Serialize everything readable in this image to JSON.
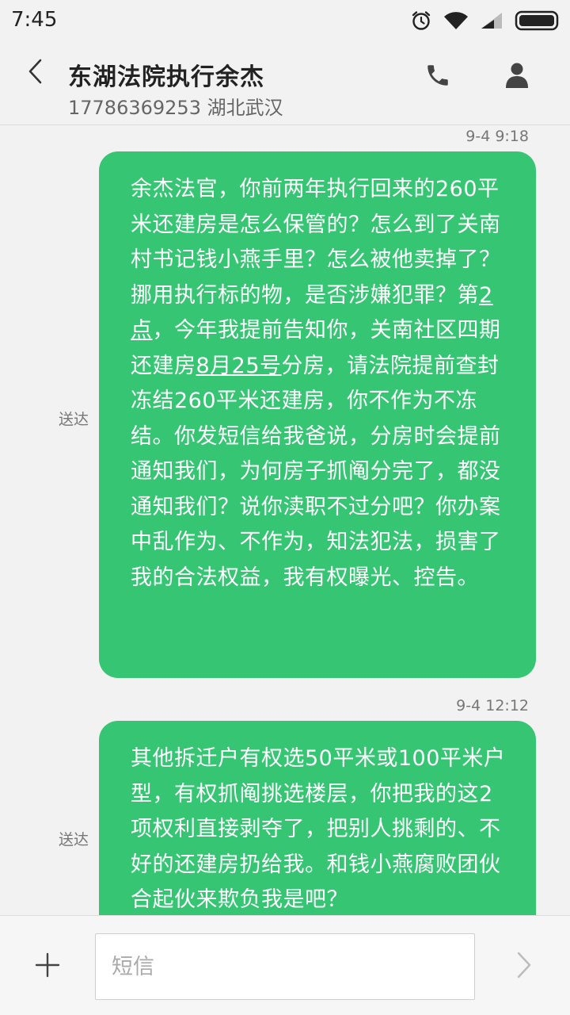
{
  "status_bar": {
    "time": "7:45"
  },
  "header": {
    "contact_name": "东湖法院执行余杰",
    "contact_sub": "17786369253 湖北武汉"
  },
  "messages": [
    {
      "timestamp": "9-4 9:18",
      "status": "送达",
      "parts": {
        "a": "余杰法官，你前两年执行回来的260平米还建房是怎么保管的？怎么到了关南村书记钱小燕手里？怎么被他卖掉了？挪用执行标的物，是否涉嫌犯罪？第",
        "link1": "2点",
        "b": "，今年我提前告知你，关南社区四期还建房",
        "link2": "8月25号",
        "c": "分房，请法院提前查封冻结260平米还建房，你不作为不冻结。你发短信给我爸说，分房时会提前通知我们，为何房子抓阄分完了，都没通知我们？说你渎职不过分吧？你办案中乱作为、不作为，知法犯法，损害了我的合法权益，我有权曝光、控告。"
      }
    },
    {
      "timestamp": "9-4 12:12",
      "status": "送达",
      "text": "其他拆迁户有权选50平米或100平米户型，有权抓阄挑选楼层，你把我的这2项权利直接剥夺了，把别人挑剩的、不好的还建房扔给我。和钱小燕腐败团伙合起伙来欺负我是吧？"
    }
  ],
  "input_bar": {
    "placeholder": "短信",
    "value": ""
  },
  "colors": {
    "bubble": "#36c573",
    "background": "#f2f2f2"
  },
  "icons": [
    "back-arrow-icon",
    "phone-icon",
    "person-icon",
    "plus-icon",
    "send-chevron-icon",
    "alarm-icon",
    "wifi-icon",
    "signal-icon",
    "battery-icon"
  ]
}
